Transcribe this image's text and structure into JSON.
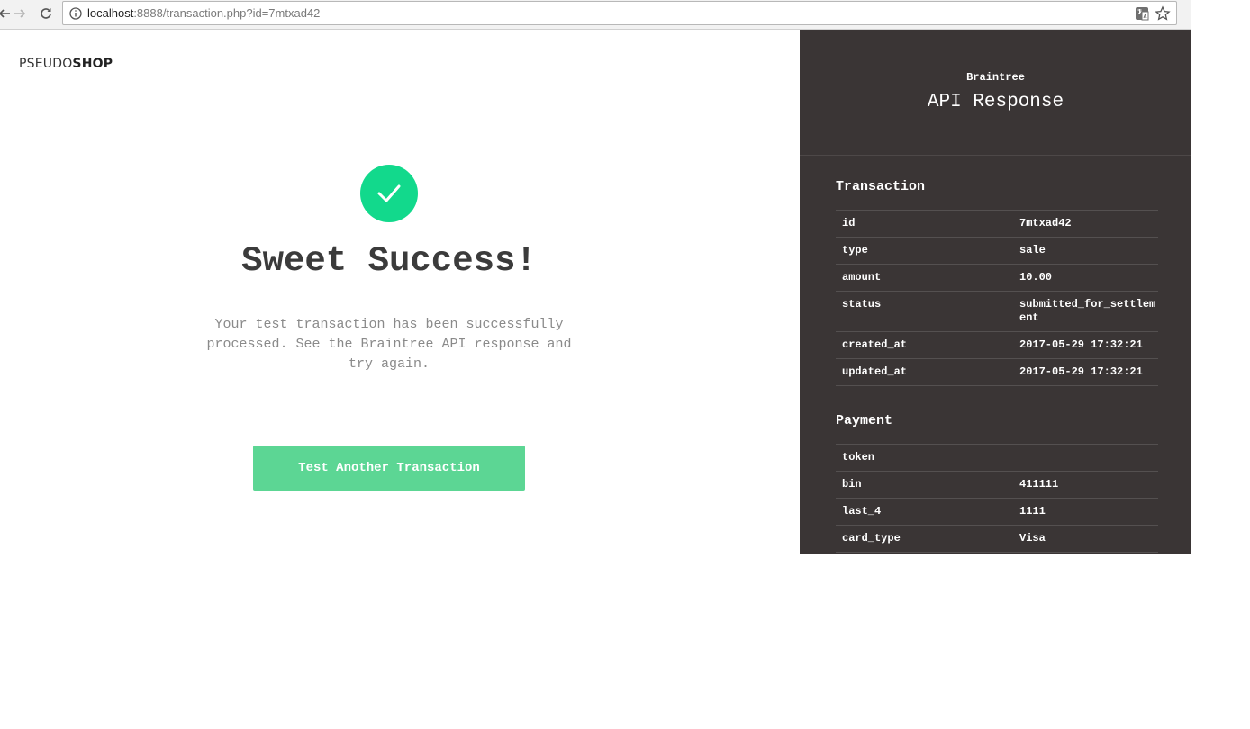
{
  "browser": {
    "url_host": "localhost",
    "url_rest": ":8888/transaction.php?id=7mtxad42"
  },
  "brand": {
    "light": "PSEUDO",
    "bold": "SHOP"
  },
  "main": {
    "headline": "Sweet Success!",
    "message": "Your test transaction has been successfully processed. See the Braintree API response and try again.",
    "cta_label": "Test Another Transaction"
  },
  "panel": {
    "eyebrow": "Braintree",
    "title": "API Response",
    "transaction": {
      "title": "Transaction",
      "rows": [
        {
          "key": "id",
          "value": "7mtxad42"
        },
        {
          "key": "type",
          "value": "sale"
        },
        {
          "key": "amount",
          "value": "10.00"
        },
        {
          "key": "status",
          "value": "submitted_for_settlement"
        },
        {
          "key": "created_at",
          "value": "2017-05-29 17:32:21"
        },
        {
          "key": "updated_at",
          "value": "2017-05-29 17:32:21"
        }
      ]
    },
    "payment": {
      "title": "Payment",
      "rows": [
        {
          "key": "token",
          "value": ""
        },
        {
          "key": "bin",
          "value": "411111"
        },
        {
          "key": "last_4",
          "value": "1111"
        },
        {
          "key": "card_type",
          "value": "Visa"
        }
      ]
    }
  },
  "colors": {
    "success_green": "#12d98c",
    "button_green": "#5cd694",
    "panel_bg": "#3a3535"
  }
}
